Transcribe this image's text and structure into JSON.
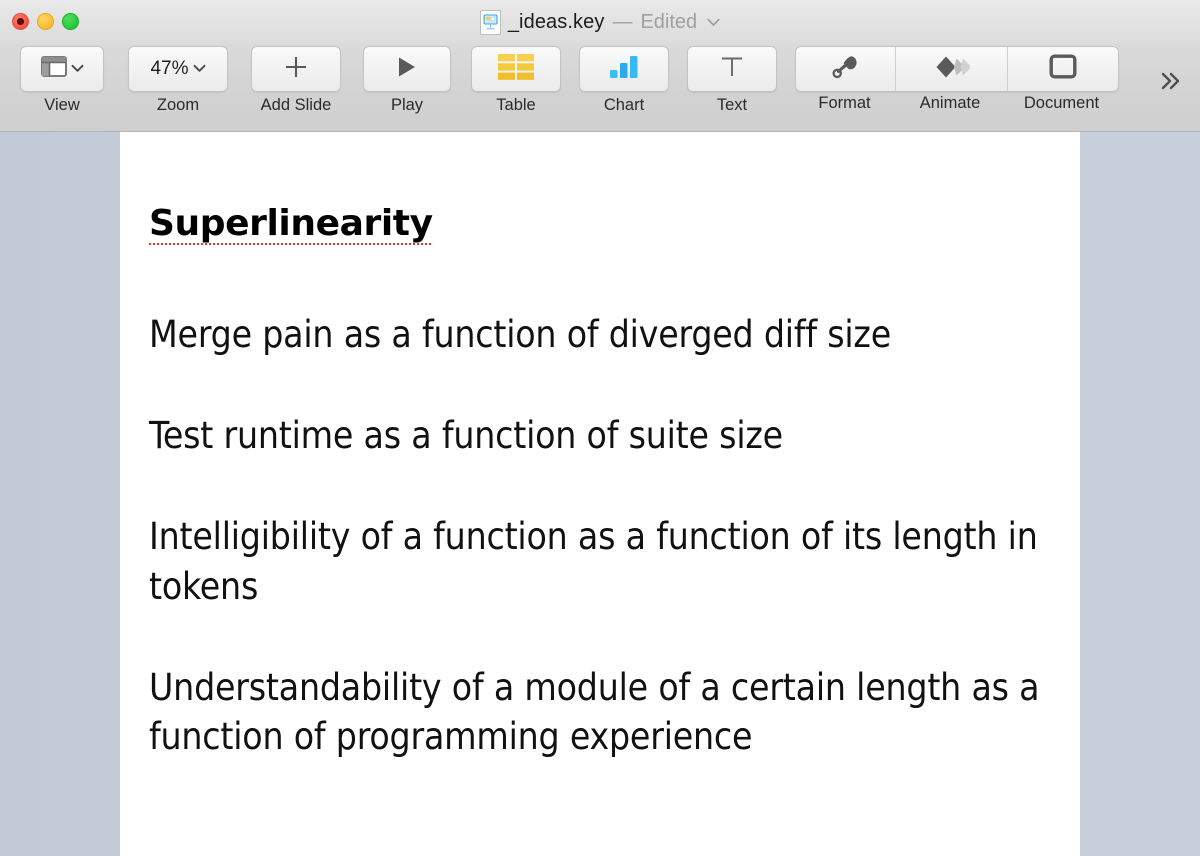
{
  "window": {
    "traffic_lights": [
      {
        "name": "close",
        "color": "#f35348"
      },
      {
        "name": "minimize",
        "color": "#febc2e"
      },
      {
        "name": "zoom",
        "color": "#27c93f"
      }
    ],
    "title": {
      "filename": "_ideas.key",
      "separator": "—",
      "status": "Edited",
      "icon": "keynote-document-icon",
      "chevron": "chevron-down-icon"
    }
  },
  "toolbar": {
    "items": [
      {
        "id": "view",
        "label": "View",
        "icon": "view-layout-icon",
        "has_chevron": true,
        "value": ""
      },
      {
        "id": "zoom",
        "label": "Zoom",
        "icon": "zoom-icon",
        "has_chevron": true,
        "value": "47%"
      },
      {
        "id": "add-slide",
        "label": "Add Slide",
        "icon": "plus-icon",
        "has_chevron": false,
        "value": ""
      },
      {
        "id": "play",
        "label": "Play",
        "icon": "play-triangle-icon",
        "has_chevron": false,
        "value": ""
      },
      {
        "id": "table",
        "label": "Table",
        "icon": "table-grid-icon",
        "has_chevron": false,
        "value": ""
      },
      {
        "id": "chart",
        "label": "Chart",
        "icon": "bar-chart-icon",
        "has_chevron": false,
        "value": ""
      },
      {
        "id": "text",
        "label": "Text",
        "icon": "text-t-icon",
        "has_chevron": false,
        "value": ""
      }
    ],
    "segmented": [
      {
        "id": "format",
        "label": "Format",
        "icon": "paintbrush-icon"
      },
      {
        "id": "animate",
        "label": "Animate",
        "icon": "animate-diamond-icon"
      },
      {
        "id": "document",
        "label": "Document",
        "icon": "document-square-icon"
      }
    ],
    "overflow_label": "»",
    "overflow_icon": "chevron-double-right-icon",
    "colors": {
      "table_icon": "#f5c93c",
      "chart_icon": "#35b8f2",
      "glyph_gray": "#555555"
    }
  },
  "slide": {
    "title": "Superlinearity",
    "title_spellcheck": true,
    "spellcheck_color": "#e8342c",
    "paragraphs": [
      "Merge pain as a function of diverged diff size",
      "Test runtime as a function of suite size",
      "Intelligibility of a function as a function of its length in tokens",
      "Understandability of a module of a certain length as a function of programming experience"
    ],
    "background_color": "#ffffff",
    "canvas_color": "#c8d0dc"
  }
}
